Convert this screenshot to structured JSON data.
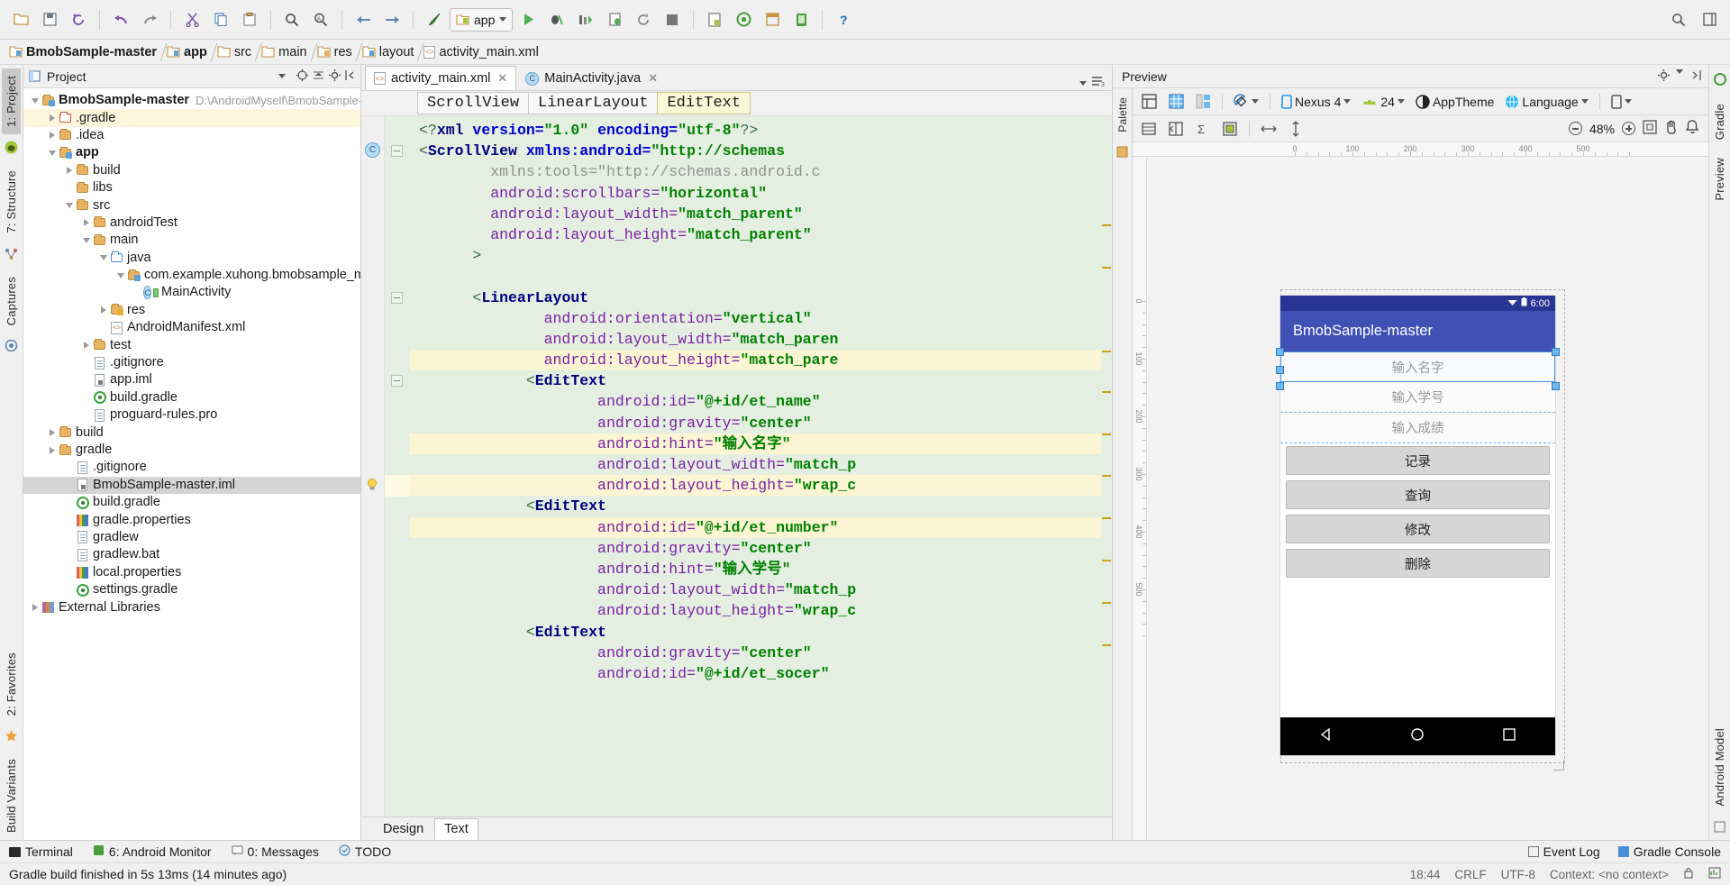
{
  "toolbar": {
    "buttons": [
      "open-folder",
      "save-all",
      "sync-project",
      "undo",
      "redo",
      "cut",
      "copy",
      "paste",
      "find",
      "replace",
      "back",
      "forward",
      "build",
      "run",
      "debug",
      "run-coverage",
      "attach-debugger",
      "rerun",
      "stop",
      "avd-manager",
      "sdk-manager",
      "layout-inspector",
      "android-monitor",
      "help"
    ],
    "run_config": "app",
    "search_hint": "search-everywhere"
  },
  "breadcrumb": [
    "BmobSample-master",
    "app",
    "src",
    "main",
    "res",
    "layout",
    "activity_main.xml"
  ],
  "project_panel": {
    "title": "Project",
    "tree": [
      {
        "depth": 0,
        "arrow": "down",
        "icon": "module",
        "label": "BmobSample-master",
        "bold": true,
        "path": "D:\\AndroidMyself\\BmobSample-m"
      },
      {
        "depth": 1,
        "arrow": "right",
        "icon": "folder-red",
        "label": ".gradle",
        "highlight": true
      },
      {
        "depth": 1,
        "arrow": "right",
        "icon": "folder",
        "label": ".idea"
      },
      {
        "depth": 1,
        "arrow": "down",
        "icon": "module",
        "label": "app",
        "bold": true
      },
      {
        "depth": 2,
        "arrow": "right",
        "icon": "folder",
        "label": "build"
      },
      {
        "depth": 2,
        "arrow": "none",
        "icon": "folder",
        "label": "libs"
      },
      {
        "depth": 2,
        "arrow": "down",
        "icon": "folder",
        "label": "src"
      },
      {
        "depth": 3,
        "arrow": "right",
        "icon": "folder",
        "label": "androidTest"
      },
      {
        "depth": 3,
        "arrow": "down",
        "icon": "folder",
        "label": "main"
      },
      {
        "depth": 4,
        "arrow": "down",
        "icon": "folder-blue",
        "label": "java"
      },
      {
        "depth": 5,
        "arrow": "down",
        "icon": "package",
        "label": "com.example.xuhong.bmobsample_ma"
      },
      {
        "depth": 6,
        "arrow": "none",
        "icon": "class",
        "label": "MainActivity"
      },
      {
        "depth": 4,
        "arrow": "right",
        "icon": "folder-res",
        "label": "res"
      },
      {
        "depth": 4,
        "arrow": "none",
        "icon": "xml",
        "label": "AndroidManifest.xml"
      },
      {
        "depth": 3,
        "arrow": "right",
        "icon": "folder",
        "label": "test"
      },
      {
        "depth": 3,
        "arrow": "none",
        "icon": "file",
        "label": ".gitignore"
      },
      {
        "depth": 3,
        "arrow": "none",
        "icon": "iml",
        "label": "app.iml"
      },
      {
        "depth": 3,
        "arrow": "none",
        "icon": "gradle",
        "label": "build.gradle"
      },
      {
        "depth": 3,
        "arrow": "none",
        "icon": "file",
        "label": "proguard-rules.pro"
      },
      {
        "depth": 1,
        "arrow": "right",
        "icon": "folder",
        "label": "build"
      },
      {
        "depth": 1,
        "arrow": "right",
        "icon": "folder",
        "label": "gradle"
      },
      {
        "depth": 2,
        "arrow": "none",
        "icon": "file",
        "label": ".gitignore"
      },
      {
        "depth": 2,
        "arrow": "none",
        "icon": "iml",
        "label": "BmobSample-master.iml",
        "selected": true
      },
      {
        "depth": 2,
        "arrow": "none",
        "icon": "gradle",
        "label": "build.gradle"
      },
      {
        "depth": 2,
        "arrow": "none",
        "icon": "prop",
        "label": "gradle.properties"
      },
      {
        "depth": 2,
        "arrow": "none",
        "icon": "file",
        "label": "gradlew"
      },
      {
        "depth": 2,
        "arrow": "none",
        "icon": "file",
        "label": "gradlew.bat"
      },
      {
        "depth": 2,
        "arrow": "none",
        "icon": "prop",
        "label": "local.properties"
      },
      {
        "depth": 2,
        "arrow": "none",
        "icon": "gradle",
        "label": "settings.gradle"
      },
      {
        "depth": 0,
        "arrow": "right",
        "icon": "lib",
        "label": "External Libraries"
      }
    ]
  },
  "left_strip": {
    "tabs": [
      "1: Project",
      "7: Structure",
      "Captures"
    ],
    "bottom_tabs": [
      "2: Favorites",
      "Build Variants"
    ]
  },
  "right_strip": {
    "tabs": [
      "Gradle",
      "Preview",
      "Android Model"
    ]
  },
  "editor": {
    "tabs": [
      {
        "label": "activity_main.xml",
        "icon": "xml-icon",
        "active": true
      },
      {
        "label": "MainActivity.java",
        "icon": "class-icon",
        "active": false
      }
    ],
    "structure_crumb": [
      {
        "label": "ScrollView",
        "selected": false
      },
      {
        "label": "LinearLayout",
        "selected": false
      },
      {
        "label": "EditText",
        "selected": true
      }
    ],
    "bottom_tabs": [
      {
        "label": "Design",
        "active": false
      },
      {
        "label": "Text",
        "active": true
      }
    ],
    "code_lines": [
      {
        "segments": [
          {
            "t": "<?",
            "c": "angle"
          },
          {
            "t": "xml",
            "c": "tag"
          },
          {
            "t": " version=",
            "c": "attrb"
          },
          {
            "t": "\"1.0\"",
            "c": "str"
          },
          {
            "t": " encoding=",
            "c": "attrb"
          },
          {
            "t": "\"utf-8\"",
            "c": "str"
          },
          {
            "t": "?>",
            "c": "angle"
          }
        ],
        "indent": 0
      },
      {
        "segments": [
          {
            "t": "<",
            "c": "angle"
          },
          {
            "t": "ScrollView",
            "c": "tag"
          },
          {
            "t": " xmlns:android=",
            "c": "attrb"
          },
          {
            "t": "\"http://schemas",
            "c": "str"
          }
        ],
        "indent": 0,
        "marker": "class"
      },
      {
        "segments": [
          {
            "t": "xmlns:tools=",
            "c": "gray"
          },
          {
            "t": "\"http://schemas.android.c",
            "c": "gray"
          }
        ],
        "indent": 4
      },
      {
        "segments": [
          {
            "t": "android:scrollbars=",
            "c": "attr"
          },
          {
            "t": "\"horizontal\"",
            "c": "str"
          }
        ],
        "indent": 4
      },
      {
        "segments": [
          {
            "t": "android:layout_width=",
            "c": "attr"
          },
          {
            "t": "\"match_parent\"",
            "c": "str"
          }
        ],
        "indent": 4
      },
      {
        "segments": [
          {
            "t": "android:layout_height=",
            "c": "attr"
          },
          {
            "t": "\"match_parent\"",
            "c": "str"
          }
        ],
        "indent": 4
      },
      {
        "segments": [
          {
            "t": ">",
            "c": "angle"
          }
        ],
        "indent": 3
      },
      {
        "segments": [],
        "indent": 0
      },
      {
        "segments": [
          {
            "t": "<",
            "c": "angle"
          },
          {
            "t": "LinearLayout",
            "c": "tag"
          }
        ],
        "indent": 3,
        "fold": true
      },
      {
        "segments": [
          {
            "t": "android:orientation=",
            "c": "attr"
          },
          {
            "t": "\"vertical\"",
            "c": "str"
          }
        ],
        "indent": 7
      },
      {
        "segments": [
          {
            "t": "android:layout_width=",
            "c": "attr"
          },
          {
            "t": "\"match_paren",
            "c": "str"
          }
        ],
        "indent": 7
      },
      {
        "segments": [
          {
            "t": "android:layout_height=",
            "c": "attr"
          },
          {
            "t": "\"match_pare",
            "c": "str"
          }
        ],
        "indent": 7,
        "hl": true
      },
      {
        "segments": [
          {
            "t": "<",
            "c": "angle"
          },
          {
            "t": "EditText",
            "c": "tag"
          }
        ],
        "indent": 6,
        "fold": true
      },
      {
        "segments": [
          {
            "t": "android:id=",
            "c": "attr"
          },
          {
            "t": "\"@+id/et_name\"",
            "c": "str"
          }
        ],
        "indent": 10
      },
      {
        "segments": [
          {
            "t": "android:gravity=",
            "c": "attr"
          },
          {
            "t": "\"center\"",
            "c": "str"
          }
        ],
        "indent": 10
      },
      {
        "segments": [
          {
            "t": "android:hint=",
            "c": "attr"
          },
          {
            "t": "\"输入名字\"",
            "c": "str"
          }
        ],
        "indent": 10,
        "hl": true
      },
      {
        "segments": [
          {
            "t": "android:layout_width=",
            "c": "attr"
          },
          {
            "t": "\"match_p",
            "c": "str"
          }
        ],
        "indent": 10
      },
      {
        "segments": [
          {
            "t": "android:layout_height=",
            "c": "attr"
          },
          {
            "t": "\"wrap_c",
            "c": "str"
          }
        ],
        "indent": 10,
        "hl": true,
        "bulb": true
      },
      {
        "segments": [
          {
            "t": "<",
            "c": "angle"
          },
          {
            "t": "EditText",
            "c": "tag"
          }
        ],
        "indent": 6
      },
      {
        "segments": [
          {
            "t": "android:id=",
            "c": "attr"
          },
          {
            "t": "\"@+id/et_number\"",
            "c": "str"
          }
        ],
        "indent": 10,
        "hl": true
      },
      {
        "segments": [
          {
            "t": "android:gravity=",
            "c": "attr"
          },
          {
            "t": "\"center\"",
            "c": "str"
          }
        ],
        "indent": 10
      },
      {
        "segments": [
          {
            "t": "android:hint=",
            "c": "attr"
          },
          {
            "t": "\"输入学号\"",
            "c": "str"
          }
        ],
        "indent": 10
      },
      {
        "segments": [
          {
            "t": "android:layout_width=",
            "c": "attr"
          },
          {
            "t": "\"match_p",
            "c": "str"
          }
        ],
        "indent": 10
      },
      {
        "segments": [
          {
            "t": "android:layout_height=",
            "c": "attr"
          },
          {
            "t": "\"wrap_c",
            "c": "str"
          }
        ],
        "indent": 10
      },
      {
        "segments": [
          {
            "t": "<",
            "c": "angle"
          },
          {
            "t": "EditText",
            "c": "tag"
          }
        ],
        "indent": 6
      },
      {
        "segments": [
          {
            "t": "android:gravity=",
            "c": "attr"
          },
          {
            "t": "\"center\"",
            "c": "str"
          }
        ],
        "indent": 10
      },
      {
        "segments": [
          {
            "t": "android:id=",
            "c": "attr"
          },
          {
            "t": "\"@+id/et_socer\"",
            "c": "str"
          }
        ],
        "indent": 10
      }
    ]
  },
  "preview": {
    "title": "Preview",
    "palette_label": "Palette",
    "device": "Nexus 4",
    "api_level": "24",
    "theme": "AppTheme",
    "language": "Language",
    "zoom": "48%",
    "app": {
      "status_time": "6:00",
      "app_title": "BmobSample-master",
      "fields": [
        {
          "hint": "输入名字",
          "selected": true
        },
        {
          "hint": "输入学号",
          "selected": false
        },
        {
          "hint": "输入成绩",
          "selected": false
        }
      ],
      "buttons": [
        "记录",
        "查询",
        "修改",
        "删除"
      ],
      "nav": [
        "back",
        "home",
        "recents"
      ]
    },
    "ruler_top": [
      "0",
      "100",
      "200",
      "300",
      "400",
      "500"
    ],
    "ruler_left": [
      "0",
      "100",
      "200",
      "300",
      "400",
      "500"
    ]
  },
  "bottom_bar": {
    "items": [
      "Terminal",
      "6: Android Monitor",
      "0: Messages",
      "TODO"
    ],
    "right": [
      "Event Log",
      "Gradle Console"
    ]
  },
  "status_bar": {
    "message": "Gradle build finished in 5s 13ms (14 minutes ago)",
    "time": "18:44",
    "line_sep": "CRLF",
    "encoding": "UTF-8",
    "context": "Context: <no context>"
  },
  "colors": {
    "appbar": "#3f51b5",
    "statusbar": "#283593",
    "code_bg": "#e4efe2",
    "selection": "#d4d4d4"
  }
}
